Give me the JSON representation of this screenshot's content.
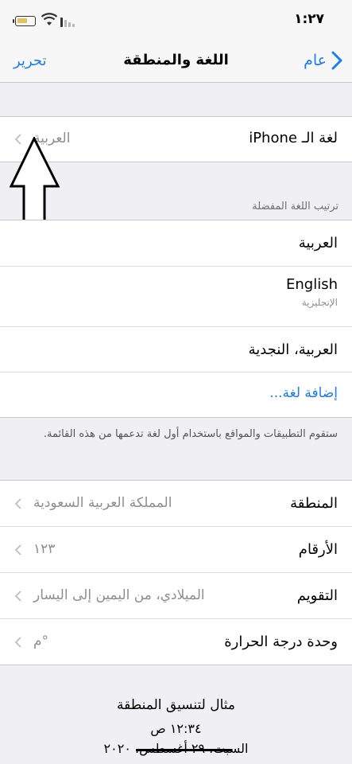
{
  "status": {
    "time": "١:٢٧"
  },
  "nav": {
    "edit_label": "تحرير",
    "title": "اللغة والمنطقة",
    "back_label": "عام"
  },
  "device_language": {
    "label": "لغة الـ iPhone",
    "value": "العربية"
  },
  "preferred": {
    "header": "ترتيب اللغة المفضلة",
    "items": [
      {
        "label": "العربية",
        "sub": ""
      },
      {
        "label": "English",
        "sub": "الإنجليزية"
      },
      {
        "label": "العربية، النجدية",
        "sub": ""
      }
    ],
    "add_label": "إضافة لغة...",
    "note": "ستقوم التطبيقات والمواقع باستخدام أول لغة تدعمها من هذه القائمة."
  },
  "settings": [
    {
      "label": "المنطقة",
      "value": "المملكة العربية السعودية"
    },
    {
      "label": "الأرقام",
      "value": "١٢٣"
    },
    {
      "label": "التقويم",
      "value": "الميلادي، من اليمين إلى اليسار"
    },
    {
      "label": "وحدة درجة الحرارة",
      "value": "°م"
    }
  ],
  "example": {
    "title": "مثال لتنسيق المنطقة",
    "time": "١٢:٣٤ ص",
    "date": "السبت، ٢٩ أغسطس، ٢٠٢٠"
  },
  "colors": {
    "accent": "#1a7df2",
    "background": "#efeff4",
    "secondary_text": "#8e8e93"
  }
}
